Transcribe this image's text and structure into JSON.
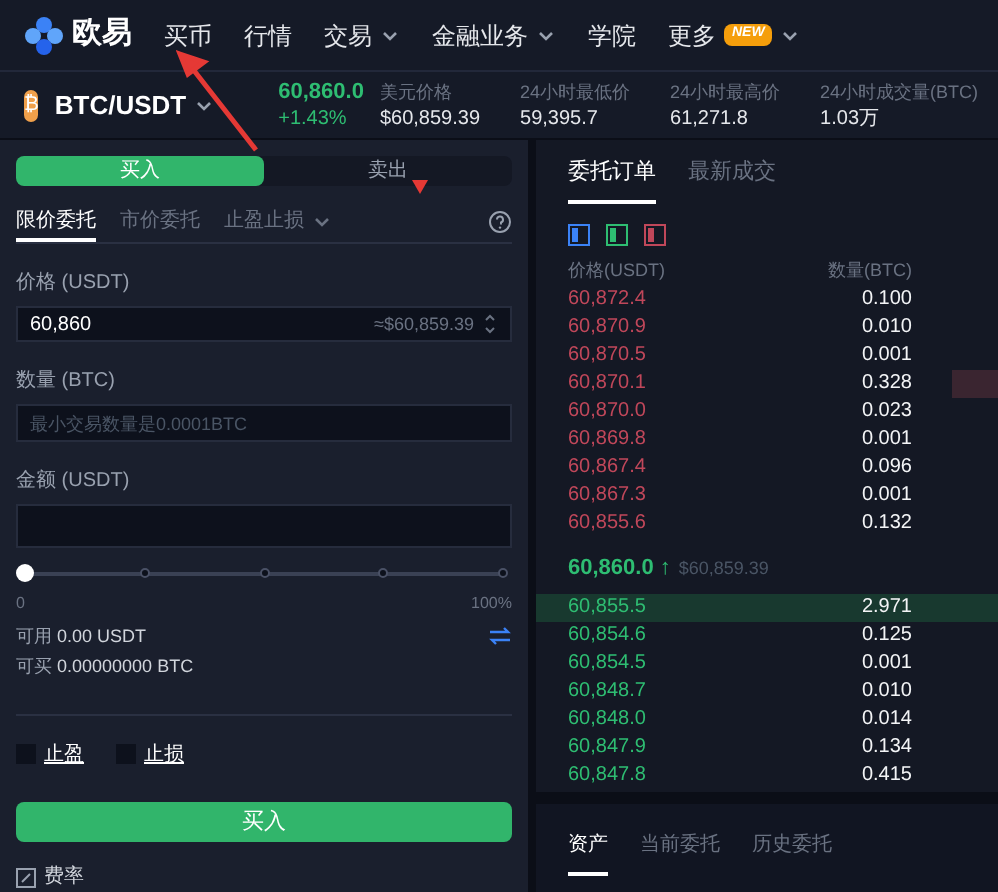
{
  "nav": {
    "brand": "欧易",
    "items": [
      {
        "label": "买币",
        "dropdown": false
      },
      {
        "label": "行情",
        "dropdown": false
      },
      {
        "label": "交易",
        "dropdown": true
      },
      {
        "label": "金融业务",
        "dropdown": true
      },
      {
        "label": "学院",
        "dropdown": false
      },
      {
        "label": "更多",
        "dropdown": true,
        "badge": "NEW"
      }
    ]
  },
  "ticker": {
    "pair": "BTC/USDT",
    "coin_letter": "₿",
    "price": "60,860.0",
    "change": "+1.43%",
    "stats": [
      {
        "label": "美元价格",
        "value": "$60,859.39"
      },
      {
        "label": "24小时最低价",
        "value": "59,395.7"
      },
      {
        "label": "24小时最高价",
        "value": "61,271.8"
      },
      {
        "label": "24小时成交量(BTC)",
        "value": "1.03万"
      }
    ]
  },
  "order_form": {
    "sides": [
      {
        "label": "买入",
        "selected": true
      },
      {
        "label": "卖出",
        "selected": false
      }
    ],
    "order_types": [
      {
        "label": "限价委托",
        "selected": true,
        "dropdown": false
      },
      {
        "label": "市价委托",
        "selected": false,
        "dropdown": false
      },
      {
        "label": "止盈止损",
        "selected": false,
        "dropdown": true
      }
    ],
    "price": {
      "label": "价格 (USDT)",
      "value": "60,860",
      "hint": "≈$60,859.39"
    },
    "amount": {
      "label": "数量 (BTC)",
      "placeholder": "最小交易数量是0.0001BTC"
    },
    "total": {
      "label": "金额 (USDT)"
    },
    "slider": {
      "level": 0,
      "min_label": "0",
      "max_label": "100%"
    },
    "available": [
      {
        "label": "可用",
        "value": "0.00 USDT"
      },
      {
        "label": "可买",
        "value": "0.00000000 BTC"
      }
    ],
    "options": [
      {
        "label": "止盈",
        "checked": false
      },
      {
        "label": "止损",
        "checked": false
      }
    ],
    "submit": "买入",
    "fee": "费率"
  },
  "order_book": {
    "tabs": [
      {
        "label": "委托订单",
        "selected": true
      },
      {
        "label": "最新成交",
        "selected": false
      }
    ],
    "columns": [
      "价格(USDT)",
      "数量(BTC)"
    ],
    "asks": [
      {
        "price": "60,872.4",
        "amount": "0.100",
        "highlighted": false
      },
      {
        "price": "60,870.9",
        "amount": "0.010",
        "highlighted": false
      },
      {
        "price": "60,870.5",
        "amount": "0.001",
        "highlighted": false
      },
      {
        "price": "60,870.1",
        "amount": "0.328",
        "highlighted": true
      },
      {
        "price": "60,870.0",
        "amount": "0.023",
        "highlighted": false
      },
      {
        "price": "60,869.8",
        "amount": "0.001",
        "highlighted": false
      },
      {
        "price": "60,867.4",
        "amount": "0.096",
        "highlighted": false
      },
      {
        "price": "60,867.3",
        "amount": "0.001",
        "highlighted": false
      },
      {
        "price": "60,855.6",
        "amount": "0.132",
        "highlighted": false
      }
    ],
    "last_price": "60,860.0",
    "last_arrow": "↑",
    "last_usd": "$60,859.39",
    "bids": [
      {
        "price": "60,855.5",
        "amount": "2.971",
        "highlighted": true
      },
      {
        "price": "60,854.6",
        "amount": "0.125",
        "highlighted": false
      },
      {
        "price": "60,854.5",
        "amount": "0.001",
        "highlighted": false
      },
      {
        "price": "60,848.7",
        "amount": "0.010",
        "highlighted": false
      },
      {
        "price": "60,848.0",
        "amount": "0.014",
        "highlighted": false
      },
      {
        "price": "60,847.9",
        "amount": "0.134",
        "highlighted": false
      },
      {
        "price": "60,847.8",
        "amount": "0.415",
        "highlighted": false
      }
    ]
  },
  "bottom_tabs": [
    {
      "label": "资产",
      "selected": true
    },
    {
      "label": "当前委托",
      "selected": false
    },
    {
      "label": "历史委托",
      "selected": false
    }
  ]
}
